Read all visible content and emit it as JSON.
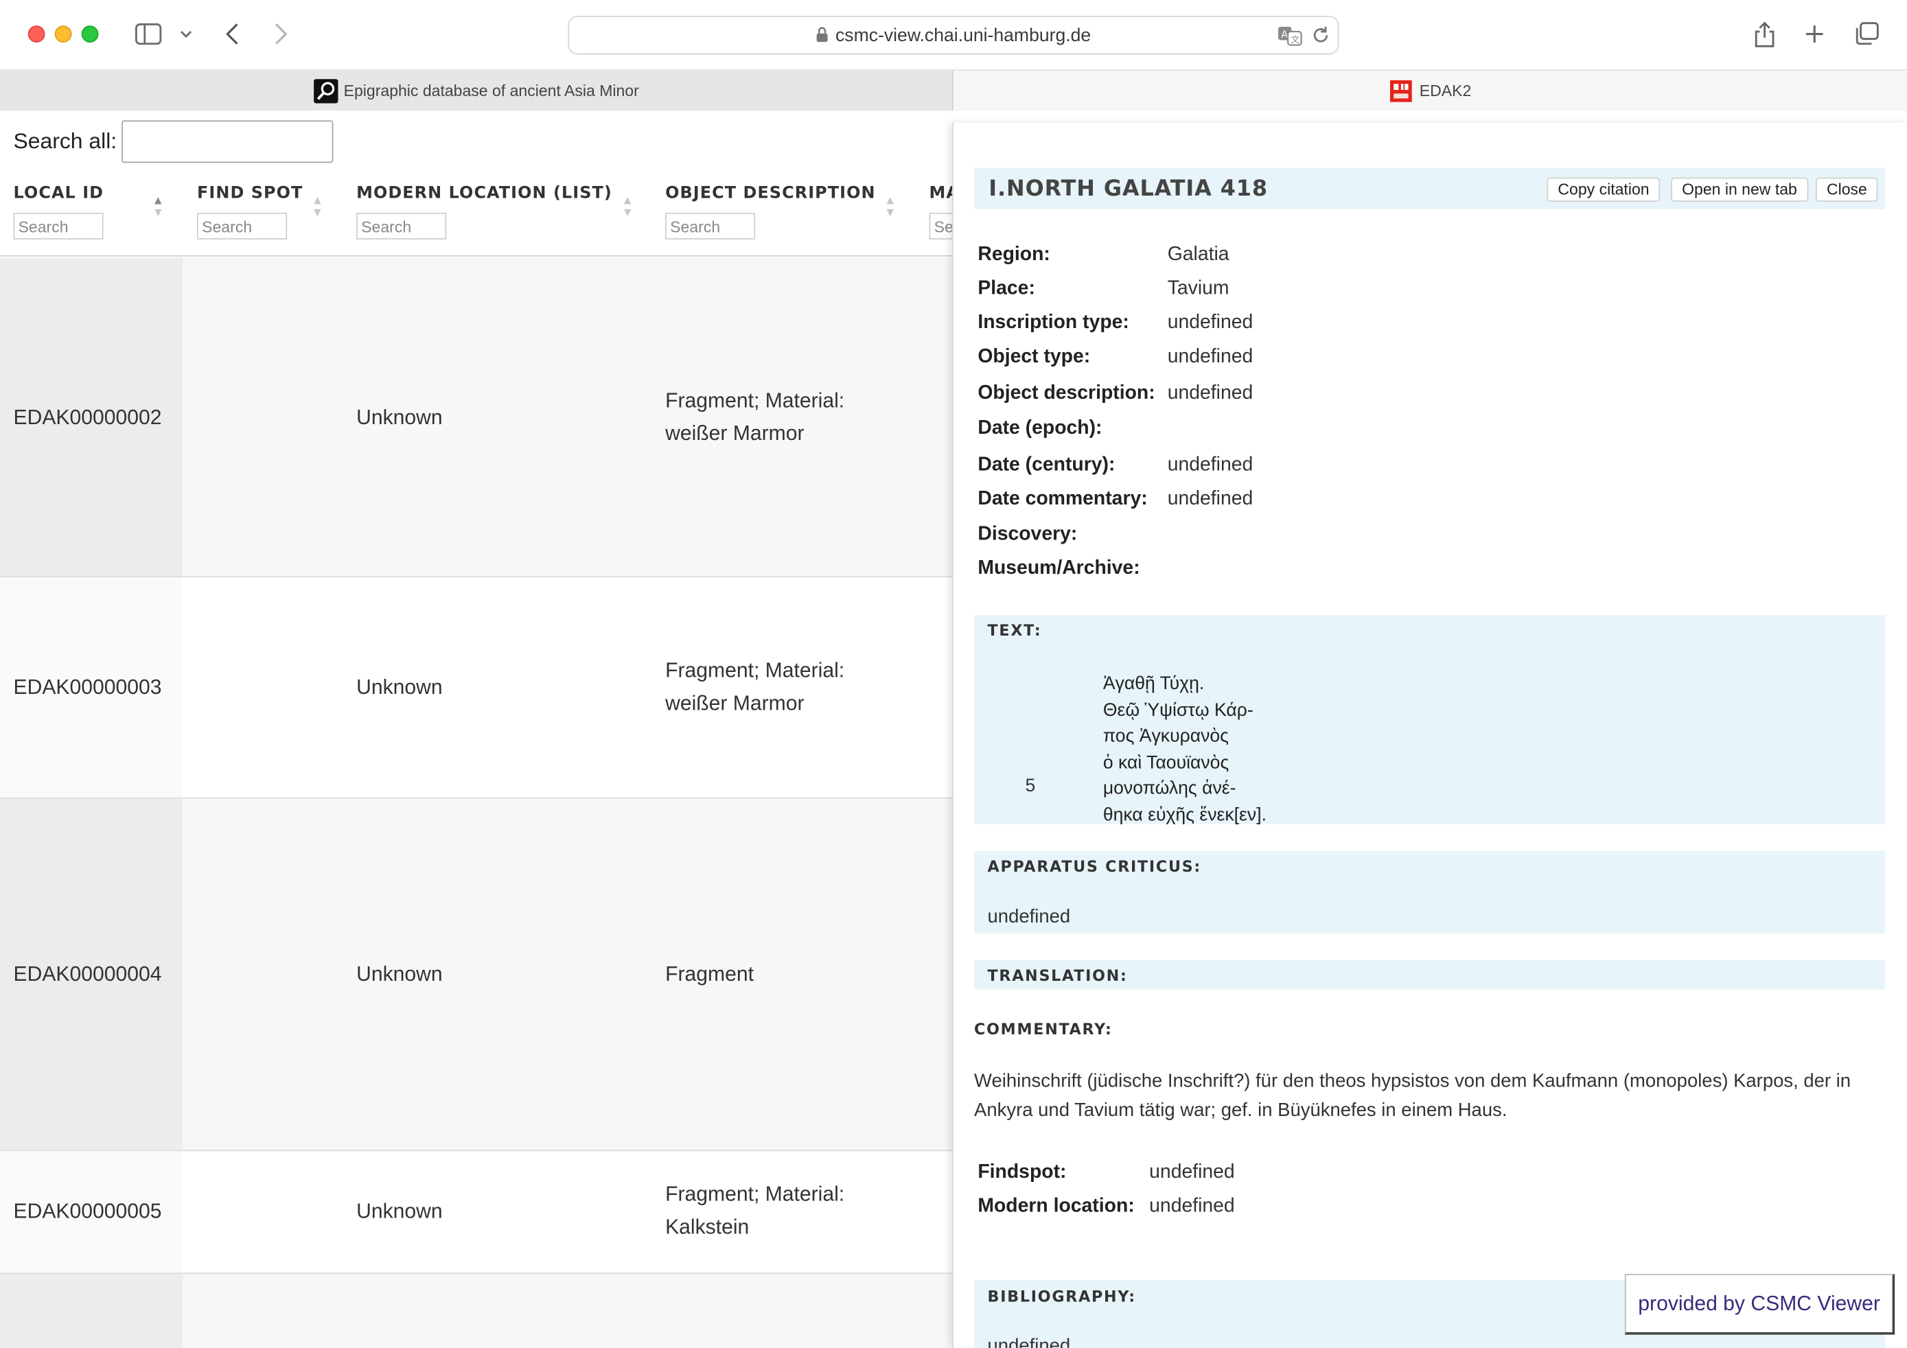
{
  "browser": {
    "url": "csmc-view.chai.uni-hamburg.de",
    "tabs": [
      {
        "label": "Epigraphic database of ancient Asia Minor"
      },
      {
        "label": "EDAK2"
      }
    ]
  },
  "table": {
    "search_all_label": "Search all:",
    "search_all_value": "",
    "column_search_placeholder": "Search",
    "columns": [
      "LOCAL ID",
      "FIND SPOT",
      "MODERN LOCATION (LIST)",
      "OBJECT DESCRIPTION",
      "MA"
    ],
    "fifth_column_search_partial": "Sea",
    "rows": [
      {
        "local_id": "EDAK00000002",
        "find_spot": "",
        "modern_location": "Unknown",
        "object_description_1": "Fragment; Material:",
        "object_description_2": "weißer Marmor"
      },
      {
        "local_id": "EDAK00000003",
        "find_spot": "",
        "modern_location": "Unknown",
        "object_description_1": "Fragment; Material:",
        "object_description_2": "weißer Marmor"
      },
      {
        "local_id": "EDAK00000004",
        "find_spot": "",
        "modern_location": "Unknown",
        "object_description_1": "Fragment",
        "object_description_2": ""
      },
      {
        "local_id": "EDAK00000005",
        "find_spot": "",
        "modern_location": "Unknown",
        "object_description_1": "Fragment; Material:",
        "object_description_2": "Kalkstein"
      }
    ]
  },
  "detail": {
    "title": "I.NORTH GALATIA 418",
    "buttons": {
      "copy": "Copy citation",
      "open": "Open in new tab",
      "close": "Close"
    },
    "fields": [
      {
        "key": "Region:",
        "value": "Galatia"
      },
      {
        "key": "Place:",
        "value": "Tavium"
      },
      {
        "key": "Inscription type:",
        "value": "undefined"
      },
      {
        "key": "Object type:",
        "value": "undefined"
      },
      {
        "key": "Object description:",
        "value": "undefined"
      },
      {
        "key": "Date (epoch):",
        "value": ""
      },
      {
        "key": "Date (century):",
        "value": "undefined"
      },
      {
        "key": "Date commentary:",
        "value": "undefined"
      },
      {
        "key": "Discovery:",
        "value": ""
      },
      {
        "key": "Museum/Archive:",
        "value": ""
      }
    ],
    "text_heading": "TEXT:",
    "text_lines": [
      "Ἀγαθῇ Τύχῃ.",
      "Θεῷ Ὑψίστῳ Κάρ-",
      "πος Ἀγκυρανὸς",
      "ὁ καὶ Ταουϊανὸς",
      "μονοπώλης ἀνέ-",
      "θηκα εὐχῆς ἕνεκ[εν]."
    ],
    "line_number": "5",
    "apparatus_heading": "APPARATUS CRITICUS:",
    "apparatus_value": "undefined",
    "translation_heading": "TRANSLATION:",
    "commentary_heading": "COMMENTARY:",
    "commentary_text": "Weihinschrift (jüdische Inschrift?) für den theos hypsistos von dem Kaufmann (monopoles) Karpos, der in Ankyra und Tavium tätig war; gef. in Büyüknefes in einem Haus.",
    "findspot_label": "Findspot:",
    "findspot_value": "undefined",
    "modern_location_label": "Modern location:",
    "modern_location_value": "undefined",
    "bibliography_heading": "BIBLIOGRAPHY:",
    "bibliography_partial": "undefined"
  },
  "provided_by": "provided by CSMC Viewer",
  "colors": {
    "section_bg": "#e7f4f9",
    "provided_text": "#3a2a7c"
  }
}
